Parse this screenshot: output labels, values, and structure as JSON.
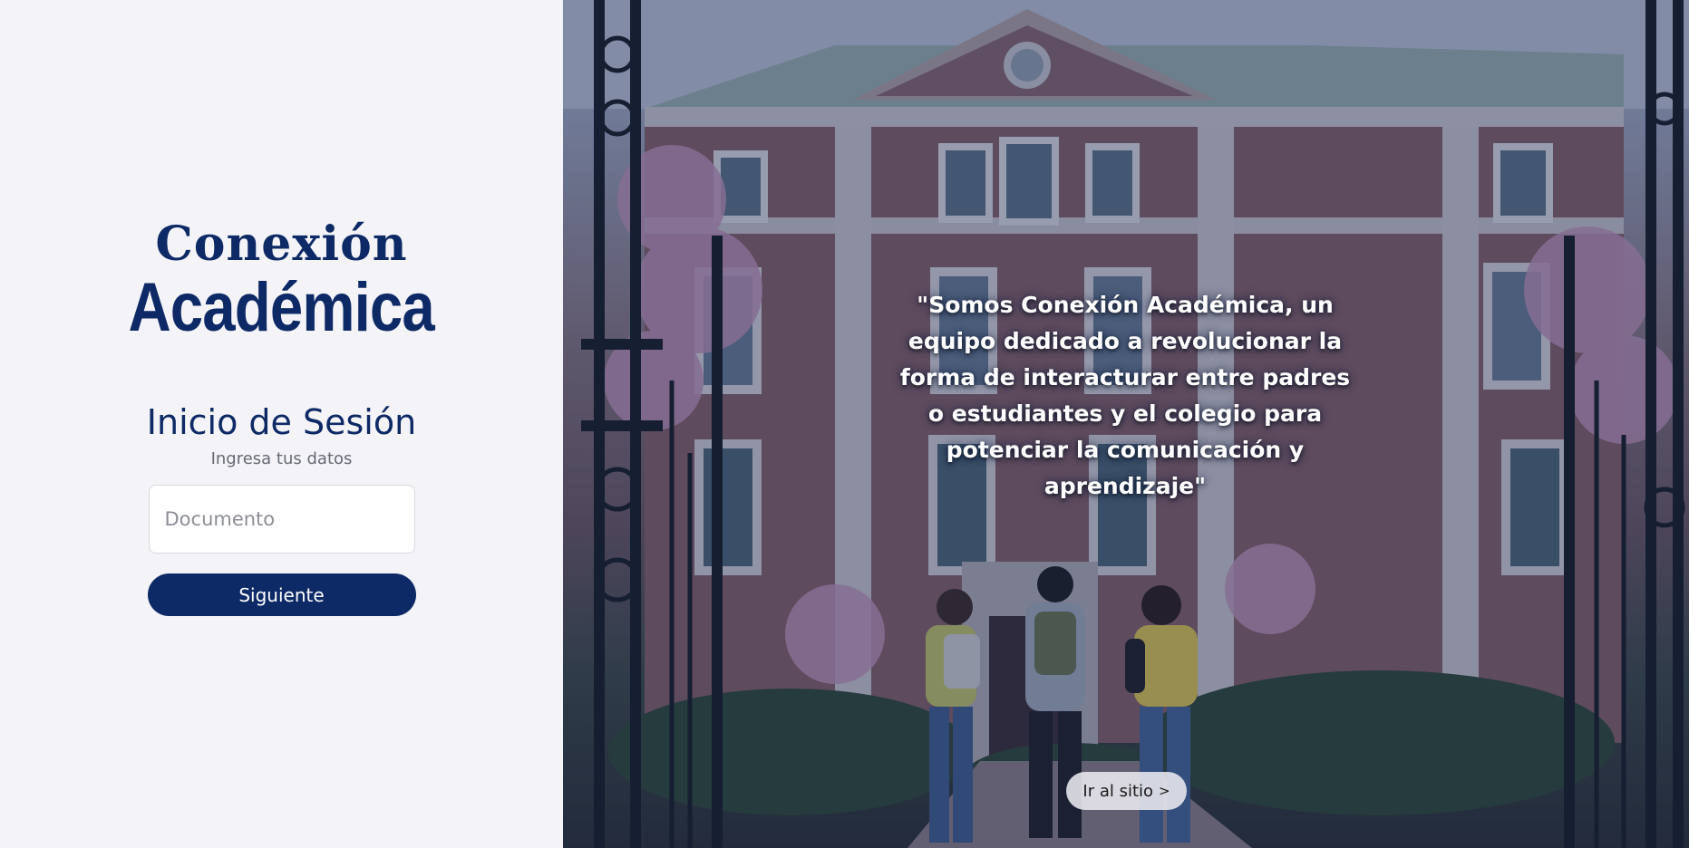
{
  "brand": {
    "line1": "Conexión",
    "line2": "Académica",
    "color": "#0e2a66"
  },
  "login": {
    "title": "Inicio de Sesión",
    "subtitle": "Ingresa tus datos",
    "document_placeholder": "Documento",
    "document_value": "",
    "next_label": "Siguiente"
  },
  "hero": {
    "quote": "\"Somos Conexión Académica, un equipo dedicado a revolucionar la forma de interacturar entre padres o estudiantes y el colegio para potenciar la comunicación y aprendizaje\"",
    "site_button_label": "Ir al sitio",
    "site_button_icon": "chevron-right-icon"
  },
  "colors": {
    "left_background": "#f4f4f8",
    "primary": "#0e2a66",
    "overlay": "rgba(24, 38, 78, 0.38)"
  }
}
